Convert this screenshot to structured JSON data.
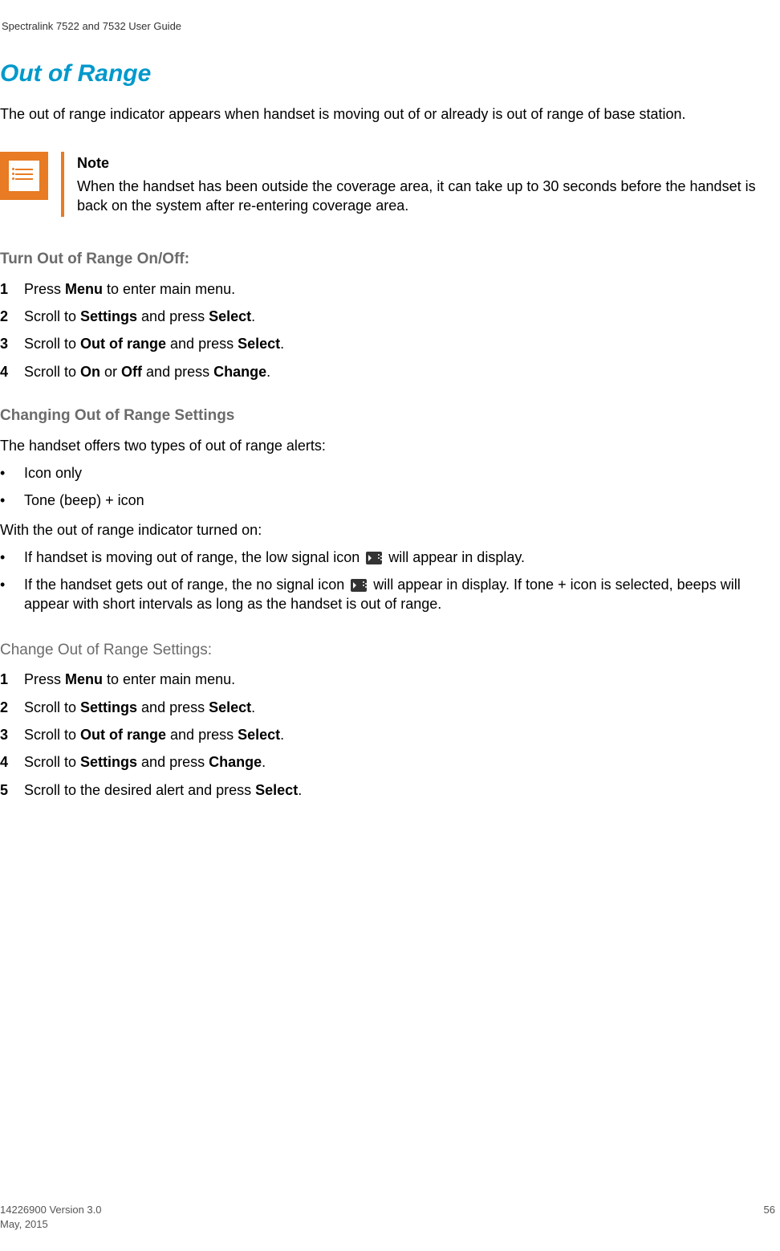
{
  "header": "Spectralink 7522 and 7532 User Guide",
  "section": {
    "title": "Out of Range",
    "intro": "The out of range indicator appears when handset is moving out of or already is out of range of base station."
  },
  "note": {
    "title": "Note",
    "body": "When the handset has been outside the coverage area, it can take up to 30 seconds before the handset is back on the system after re-entering coverage area."
  },
  "sub1": {
    "title": "Turn Out of Range On/Off:",
    "steps": [
      {
        "num": "1",
        "prefix": "Press ",
        "b1": "Menu",
        "mid1": " to enter main menu."
      },
      {
        "num": "2",
        "prefix": "Scroll to ",
        "b1": "Settings",
        "mid1": " and press ",
        "b2": "Select",
        "suffix": "."
      },
      {
        "num": "3",
        "prefix": "Scroll to ",
        "b1": "Out of range",
        "mid1": " and press ",
        "b2": "Select",
        "suffix": "."
      },
      {
        "num": "4",
        "prefix": "Scroll to ",
        "b1": "On",
        "mid1": " or ",
        "b2": "Off",
        "mid2": " and press ",
        "b3": "Change",
        "suffix": "."
      }
    ]
  },
  "sub2": {
    "title": "Changing Out of Range Settings",
    "para1": "The handset offers two types of out of range alerts:",
    "bullets1": [
      "Icon only",
      "Tone (beep) + icon"
    ],
    "para2": "With the out of range indicator turned on:",
    "bullets2": [
      {
        "pre": "If handset is moving out of range, the low signal icon ",
        "post": " will appear in display."
      },
      {
        "pre": "If the handset gets out of range, the no signal icon ",
        "post": " will appear in display. If tone + icon is selected, beeps will appear with short intervals as long as the handset is out of range."
      }
    ]
  },
  "sub3": {
    "title": "Change Out of Range Settings:",
    "steps": [
      {
        "num": "1",
        "prefix": "Press ",
        "b1": "Menu",
        "mid1": " to enter main menu."
      },
      {
        "num": "2",
        "prefix": "Scroll to ",
        "b1": "Settings",
        "mid1": " and press ",
        "b2": "Select",
        "suffix": "."
      },
      {
        "num": "3",
        "prefix": "Scroll to ",
        "b1": "Out of range",
        "mid1": " and press ",
        "b2": "Select",
        "suffix": "."
      },
      {
        "num": "4",
        "prefix": "Scroll to ",
        "b1": "Settings",
        "mid1": " and press ",
        "b2": "Change",
        "suffix": "."
      },
      {
        "num": "5",
        "prefix": "Scroll to the desired alert and press ",
        "b1": "Select",
        "suffix": "."
      }
    ]
  },
  "footer": {
    "line1": "14226900 Version 3.0",
    "line2": "May, 2015",
    "page": "56"
  }
}
